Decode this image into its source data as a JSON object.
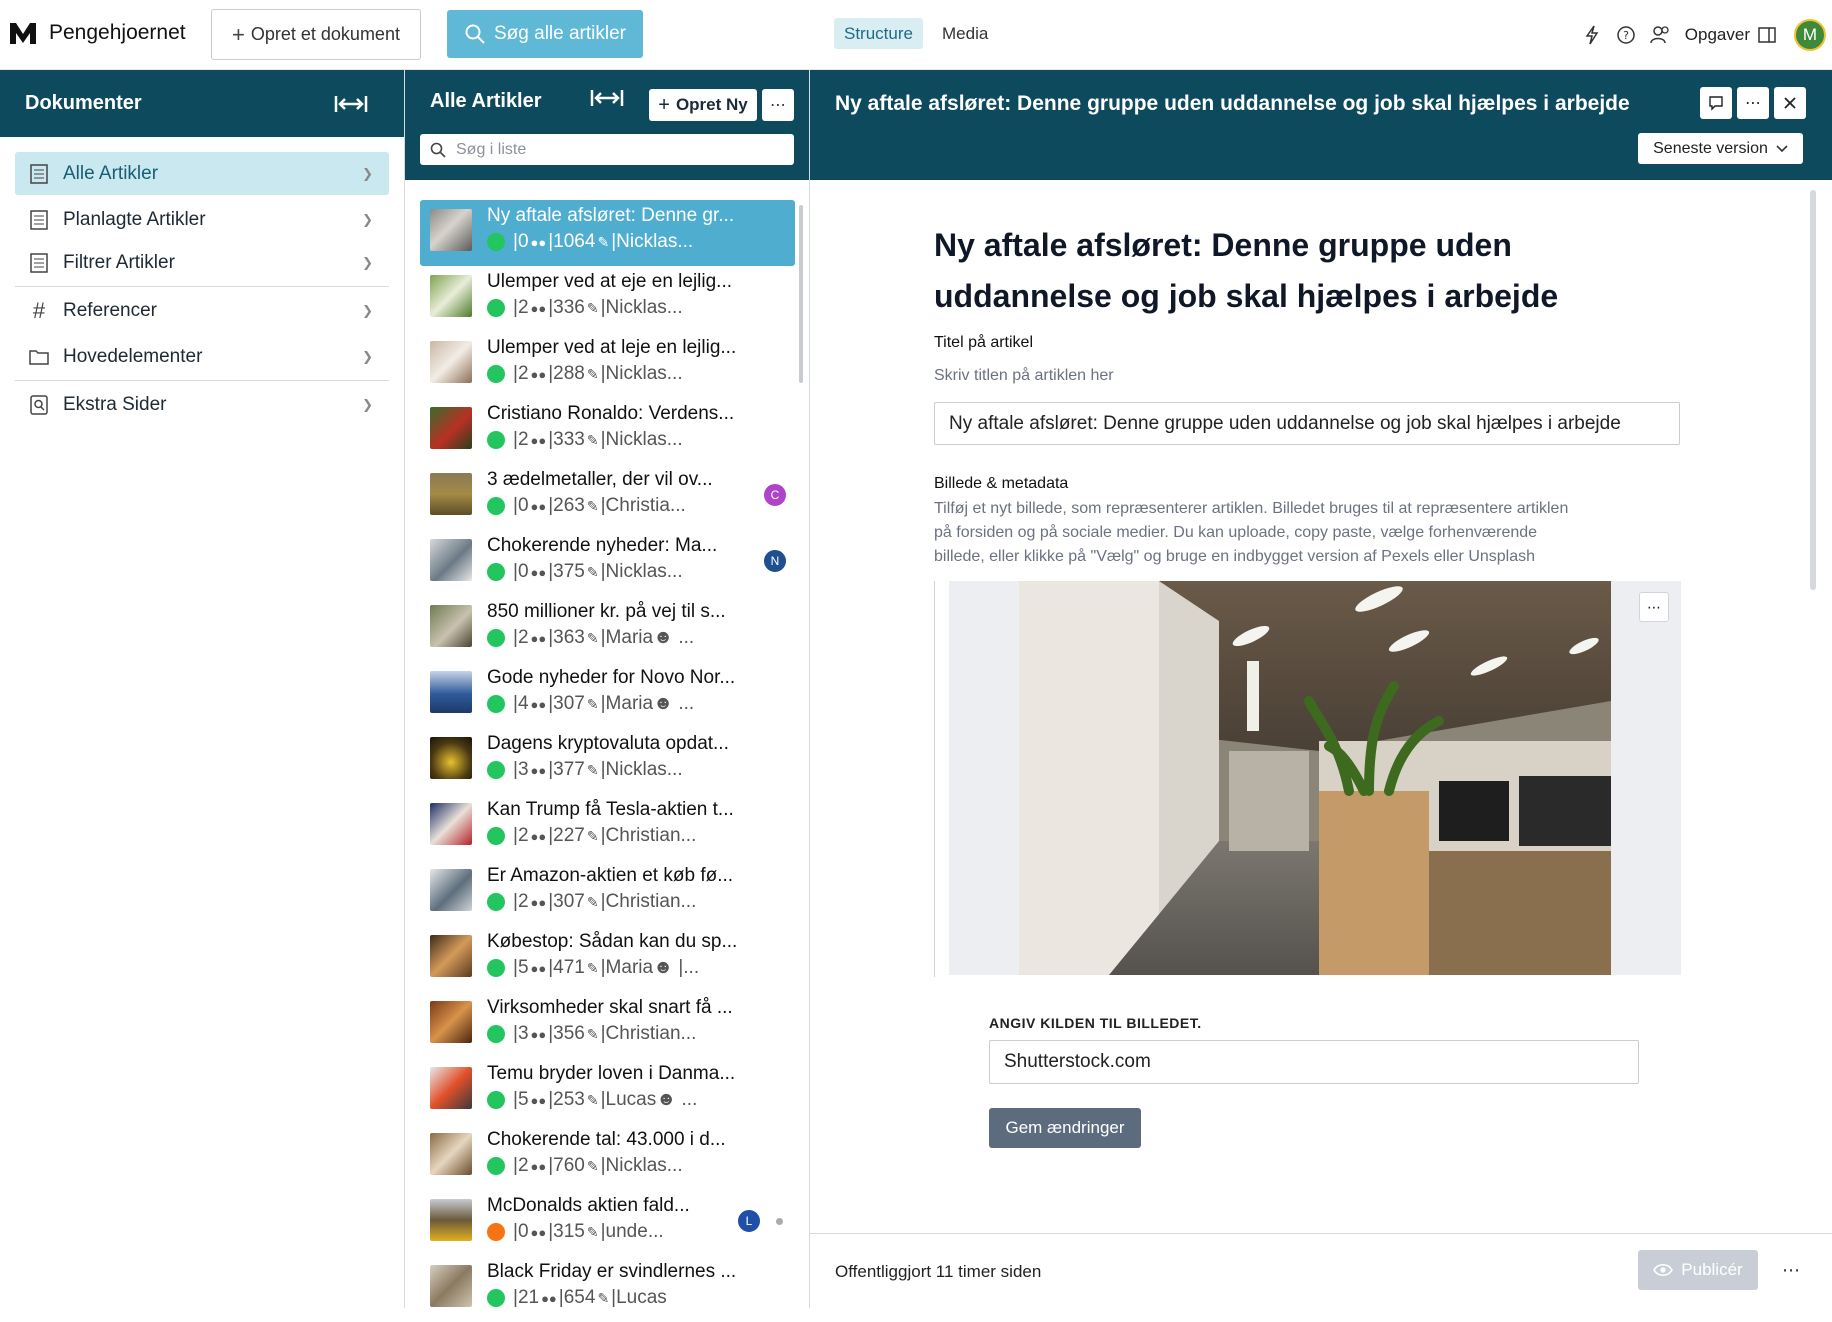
{
  "brand": "Pengehjoernet",
  "toolbar": {
    "create_label": "Opret et dokument",
    "search_label": "Søg alle artikler",
    "tabs": [
      "Structure",
      "Media"
    ],
    "tasks_label": "Opgaver",
    "avatar_initial": "M"
  },
  "sidebar": {
    "title": "Dokumenter",
    "items": [
      {
        "label": "Alle Artikler",
        "icon": "document-list-icon",
        "active": true
      },
      {
        "label": "Planlagte Artikler",
        "icon": "document-list-icon"
      },
      {
        "label": "Filtrer Artikler",
        "icon": "document-list-icon"
      },
      {
        "label": "Referencer",
        "icon": "hash-icon"
      },
      {
        "label": "Hovedelementer",
        "icon": "folder-icon"
      },
      {
        "label": "Ekstra Sider",
        "icon": "search-document-icon"
      }
    ]
  },
  "list": {
    "title": "Alle Artikler",
    "new_label": "Opret Ny",
    "search_placeholder": "Søg i liste",
    "articles": [
      {
        "title": "Ny aftale afsløret: Denne gr...",
        "comments": "0",
        "views": "1064",
        "author": "Nicklas...",
        "status": "green"
      },
      {
        "title": "Ulemper ved at eje en lejlig...",
        "comments": "2",
        "views": "336",
        "author": "Nicklas...",
        "status": "green"
      },
      {
        "title": "Ulemper ved at leje en lejlig...",
        "comments": "2",
        "views": "288",
        "author": "Nicklas...",
        "status": "green"
      },
      {
        "title": "Cristiano Ronaldo: Verdens...",
        "comments": "2",
        "views": "333",
        "author": "Nicklas...",
        "status": "green"
      },
      {
        "title": "3 ædelmetaller, der vil ov...",
        "comments": "0",
        "views": "263",
        "author": "Christia...",
        "status": "green",
        "badge": "C"
      },
      {
        "title": "Chokerende nyheder: Ma...",
        "comments": "0",
        "views": "375",
        "author": "Nicklas...",
        "status": "green",
        "badge": "N"
      },
      {
        "title": "850 millioner kr. på vej til s...",
        "comments": "2",
        "views": "363",
        "author": "Maria",
        "status": "green"
      },
      {
        "title": "Gode nyheder for Novo Nor...",
        "comments": "4",
        "views": "307",
        "author": "Maria",
        "status": "green"
      },
      {
        "title": "Dagens kryptovaluta opdat...",
        "comments": "3",
        "views": "377",
        "author": "Nicklas...",
        "status": "green"
      },
      {
        "title": "Kan Trump få Tesla-aktien t...",
        "comments": "2",
        "views": "227",
        "author": "Christian...",
        "status": "green"
      },
      {
        "title": "Er Amazon-aktien et køb fø...",
        "comments": "2",
        "views": "307",
        "author": "Christian...",
        "status": "green"
      },
      {
        "title": "Købestop: Sådan kan du sp...",
        "comments": "5",
        "views": "471",
        "author": "Maria",
        "status": "green"
      },
      {
        "title": "Virksomheder skal snart få ...",
        "comments": "3",
        "views": "356",
        "author": "Christian...",
        "status": "green"
      },
      {
        "title": "Temu bryder loven i Danma...",
        "comments": "5",
        "views": "253",
        "author": "Lucas",
        "status": "green"
      },
      {
        "title": "Chokerende tal: 43.000 i d...",
        "comments": "2",
        "views": "760",
        "author": "Nicklas...",
        "status": "green"
      },
      {
        "title": "McDonalds aktien fald...",
        "comments": "0",
        "views": "315",
        "author": "unde...",
        "status": "orange",
        "badge": "L"
      },
      {
        "title": "Black Friday er svindlernes ...",
        "comments": "21",
        "views": "654",
        "author": "Lucas",
        "status": "green"
      }
    ]
  },
  "editor": {
    "header_title": "Ny aftale afsløret: Denne gruppe uden uddannelse og job skal hjælpes i arbejde",
    "version_label": "Seneste version",
    "doc_title_line1": "Ny aftale afsløret: Denne gruppe uden",
    "doc_title_line2": "uddannelse og job skal hjælpes i arbejde",
    "title_label": "Titel på artikel",
    "title_hint": "Skriv titlen på artiklen her",
    "title_value": "Ny aftale afsløret: Denne gruppe uden uddannelse og job skal hjælpes i arbejde",
    "image_label": "Billede & metadata",
    "image_hint": "Tilføj et nyt billede, som repræsenterer artiklen. Billedet bruges til at repræsentere artiklen på forsiden og på sociale medier. Du kan uploade, copy paste, vælge forhenværende billede, eller klikke på \"Vælg\" og bruge en indbygget version af Pexels eller Unsplash",
    "source_label": "ANGIV KILDEN TIL BILLEDET.",
    "source_value": "Shutterstock.com",
    "save_label": "Gem ændringer",
    "published_text": "Offentliggjort 11 timer siden",
    "publish_label": "Publicér"
  },
  "colors": {
    "header": "#0e4a5e",
    "accent": "#5fb9d6",
    "active_item": "#4faed0",
    "status_green": "#22c55e",
    "status_orange": "#f97316"
  }
}
